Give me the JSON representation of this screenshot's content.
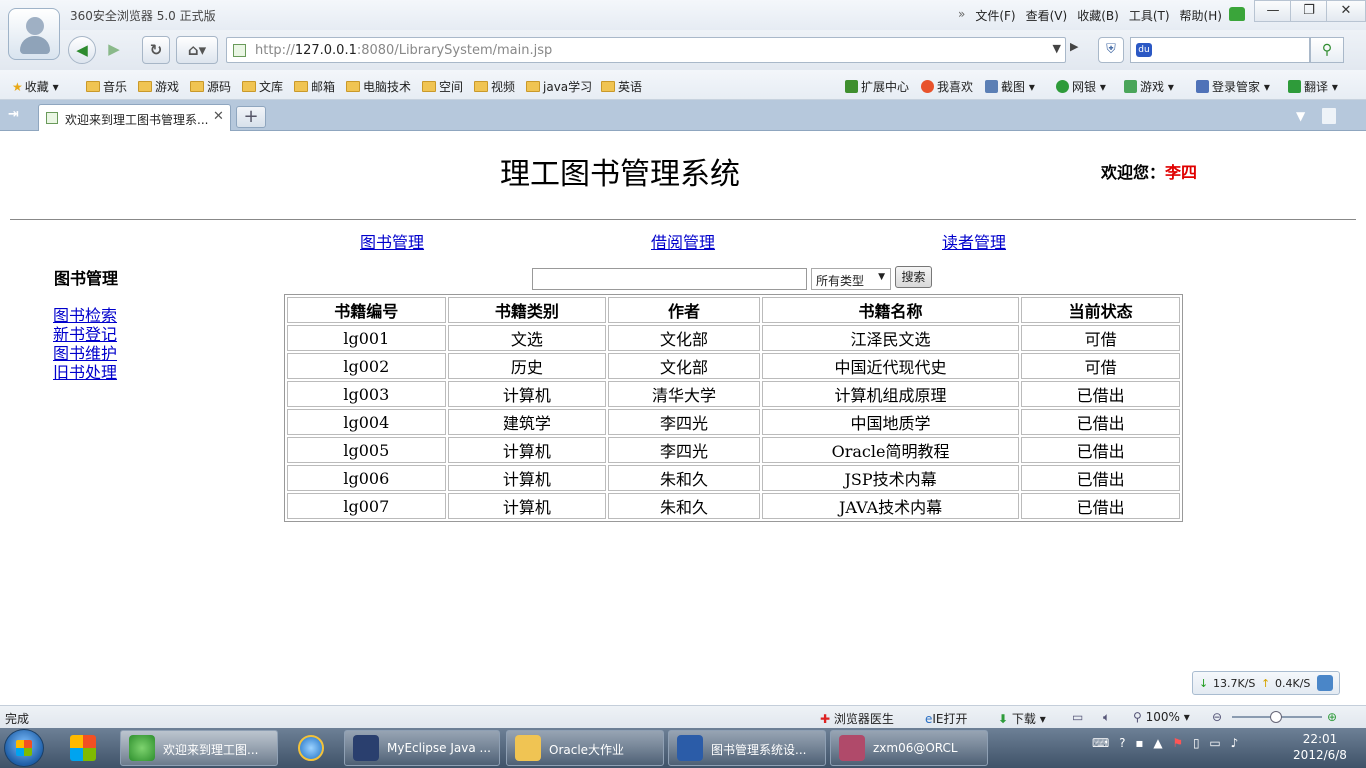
{
  "app": {
    "title": "360安全浏览器 5.0 正式版",
    "menu": [
      "文件(F)",
      "查看(V)",
      "收藏(B)",
      "工具(T)",
      "帮助(H)"
    ],
    "menu_chevron": "»",
    "window_buttons": {
      "minimize": "—",
      "maximize": "❐",
      "close": "✕"
    }
  },
  "nav": {
    "back": "◀",
    "forward": "▶",
    "refresh": "↻",
    "home": "⌂▾",
    "address_host": "http://",
    "address_bold": "127.0.0.1",
    "address_rest": ":8080/LibrarySystem/main.jsp",
    "search_value": ""
  },
  "bookmarks": {
    "favorites": "收藏",
    "folders": [
      "音乐",
      "游戏",
      "源码",
      "文库",
      "邮箱",
      "电脑技术",
      "空间",
      "视频",
      "java学习",
      "英语"
    ],
    "tools": [
      "扩展中心",
      "我喜欢",
      "截图",
      "网银",
      "游戏",
      "登录管家",
      "翻译"
    ]
  },
  "tabs": [
    {
      "title": "欢迎来到理工图书管理系...",
      "active": true
    }
  ],
  "page": {
    "system_title": "理工图书管理系统",
    "welcome_label": "欢迎您：",
    "welcome_user": "李四",
    "top_links": [
      "图书管理",
      "借阅管理",
      "读者管理"
    ],
    "side_heading": "图书管理",
    "side_links": [
      "图书检索",
      "新书登记",
      "图书维护",
      "旧书处理"
    ],
    "search": {
      "query": "",
      "type_selected": "所有类型",
      "button": "搜索"
    },
    "table": {
      "headers": [
        "书籍编号",
        "书籍类别",
        "作者",
        "书籍名称",
        "当前状态"
      ],
      "rows": [
        [
          "lg001",
          "文选",
          "文化部",
          "江泽民文选",
          "可借"
        ],
        [
          "lg002",
          "历史",
          "文化部",
          "中国近代现代史",
          "可借"
        ],
        [
          "lg003",
          "计算机",
          "清华大学",
          "计算机组成原理",
          "已借出"
        ],
        [
          "lg004",
          "建筑学",
          "李四光",
          "中国地质学",
          "已借出"
        ],
        [
          "lg005",
          "计算机",
          "李四光",
          "Oracle简明教程",
          "已借出"
        ],
        [
          "lg006",
          "计算机",
          "朱和久",
          "JSP技术内幕",
          "已借出"
        ],
        [
          "lg007",
          "计算机",
          "朱和久",
          "JAVA技术内幕",
          "已借出"
        ]
      ]
    }
  },
  "speed": {
    "down": "13.7K/S",
    "up": "0.4K/S"
  },
  "status": {
    "text": "完成",
    "items": [
      "浏览器医生",
      "IE打开",
      "下载"
    ],
    "zoom": "100%"
  },
  "taskbar": {
    "tasks": [
      {
        "label": "欢迎来到理工图...",
        "active": true
      },
      {
        "label": "MyEclipse Java ...",
        "active": false
      },
      {
        "label": "Oracle大作业",
        "active": false
      },
      {
        "label": "图书管理系统设...",
        "active": false
      },
      {
        "label": "zxm06@ORCL",
        "active": false
      }
    ],
    "time": "22:01",
    "date": "2012/6/8"
  },
  "colors": {
    "link": "#0000cc",
    "welcome_user": "#e00000",
    "tab_bar": "#b6c8dc"
  }
}
